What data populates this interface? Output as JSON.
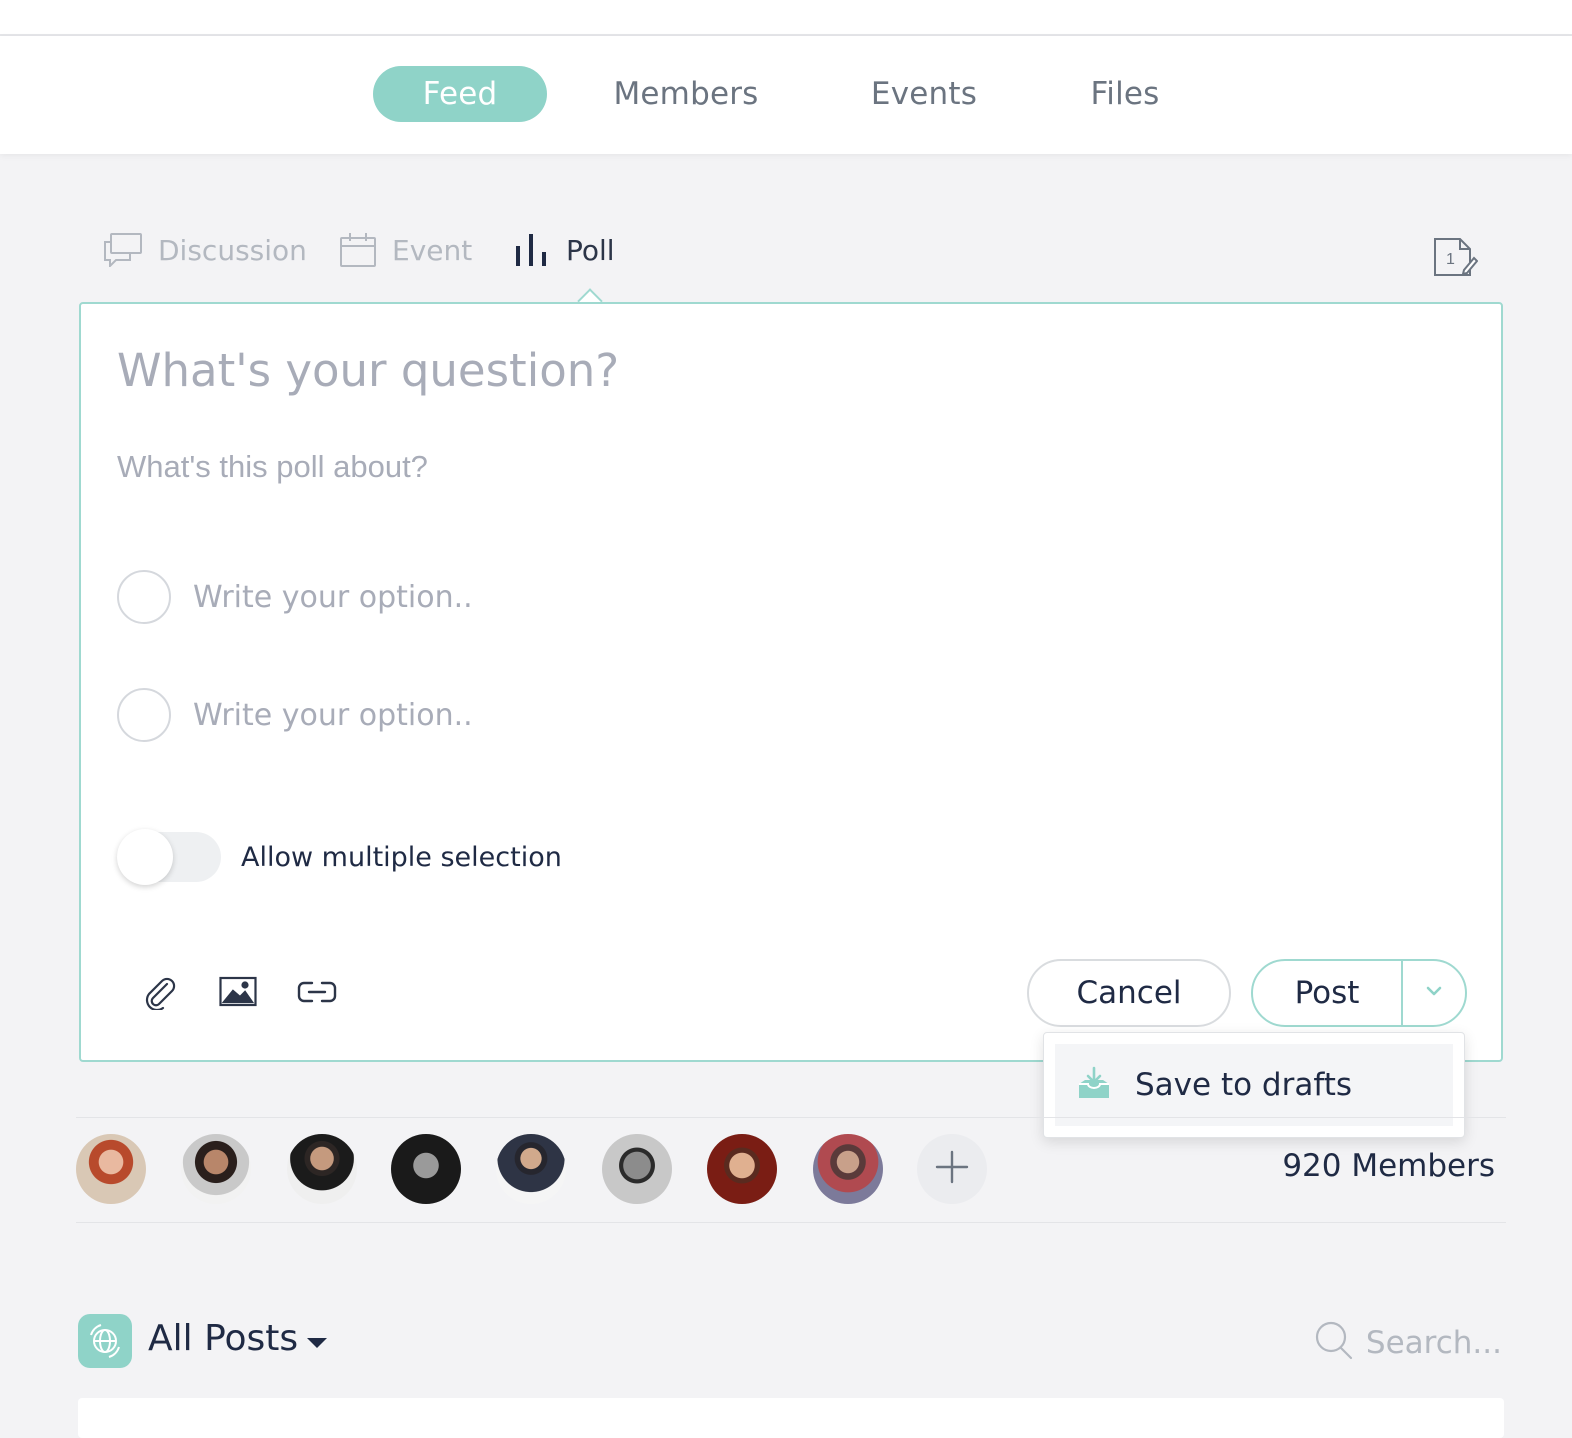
{
  "nav": {
    "tabs": [
      {
        "label": "Feed",
        "active": true
      },
      {
        "label": "Members",
        "active": false
      },
      {
        "label": "Events",
        "active": false
      },
      {
        "label": "Files",
        "active": false
      }
    ]
  },
  "post_types": [
    {
      "label": "Discussion",
      "icon": "discussion-icon",
      "active": false
    },
    {
      "label": "Event",
      "icon": "calendar-icon",
      "active": false
    },
    {
      "label": "Poll",
      "icon": "poll-icon",
      "active": true
    }
  ],
  "drafts": {
    "count": "1"
  },
  "composer": {
    "question_placeholder": "What's your question?",
    "description_placeholder": "What's this poll about?",
    "option_placeholder_1": "Write your option..",
    "option_placeholder_2": "Write your option..",
    "multiple_selection_label": "Allow multiple selection",
    "multiple_selection_enabled": false,
    "cancel_label": "Cancel",
    "post_label": "Post"
  },
  "post_menu": {
    "save_to_drafts_label": "Save to drafts"
  },
  "members": {
    "count_label": "920 Members",
    "avatar_count": 8
  },
  "feed": {
    "filter_label": "All Posts",
    "search_placeholder": "Search..."
  },
  "colors": {
    "accent": "#8fd3c8",
    "border_accent": "#9fd9d0",
    "text": "#1f2a44",
    "muted": "#a8acb8"
  }
}
